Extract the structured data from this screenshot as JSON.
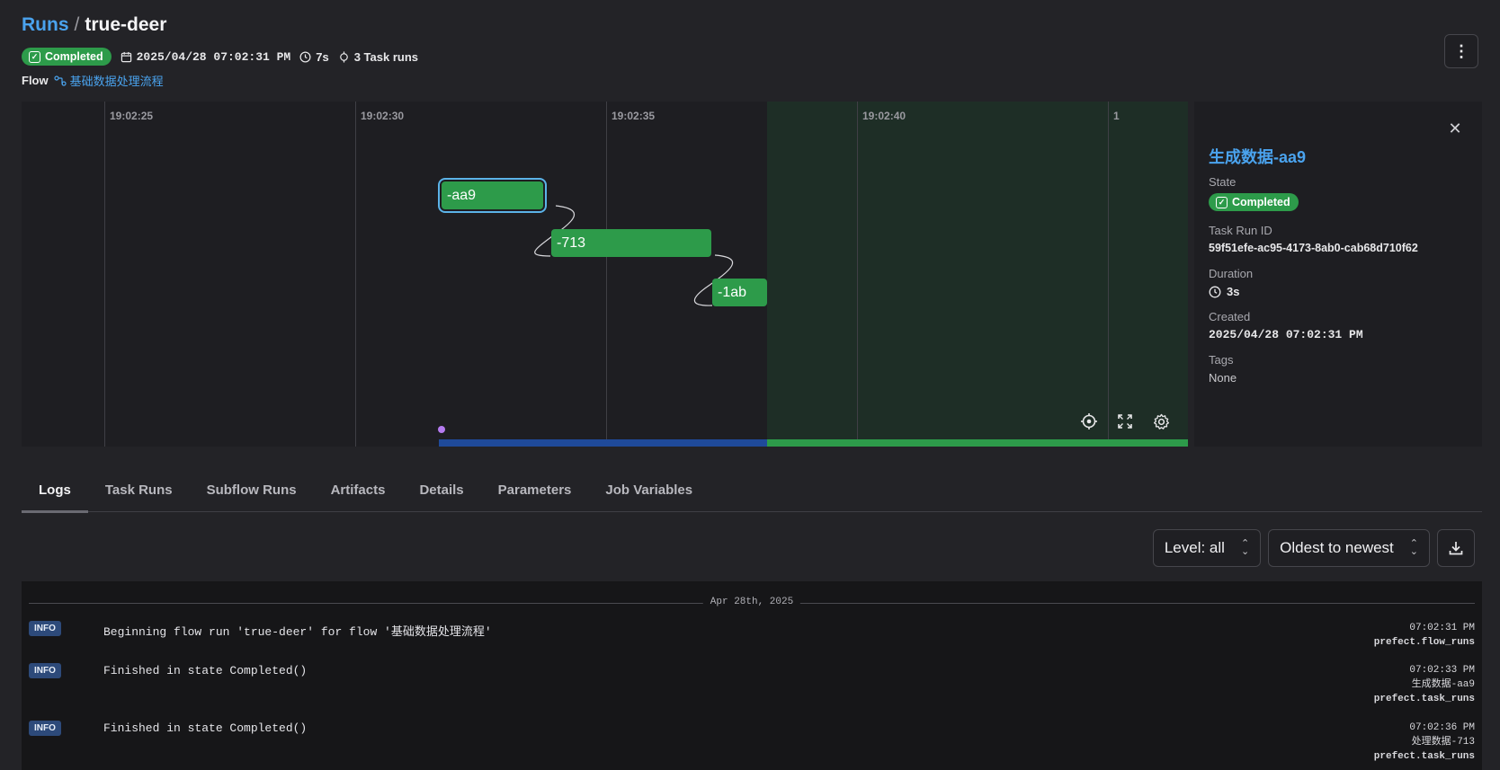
{
  "header": {
    "breadcrumb_root": "Runs",
    "breadcrumb_sep": "/",
    "run_name": "true-deer",
    "state_badge": "Completed",
    "start_time": "2025/04/28 07:02:31 PM",
    "duration": "7s",
    "task_runs": "3 Task runs",
    "flow_label": "Flow",
    "flow_name": "基础数据处理流程",
    "menu_icon": "vertical-ellipsis-icon"
  },
  "timeline": {
    "ticks": [
      "19:02:25",
      "19:02:30",
      "19:02:35",
      "19:02:40",
      "1"
    ],
    "nodes": [
      {
        "label": "-aa9",
        "selected": true
      },
      {
        "label": "-713",
        "selected": false
      },
      {
        "label": "-1ab",
        "selected": false
      }
    ],
    "controls": [
      "crosshair-icon",
      "fullscreen-icon",
      "settings-icon"
    ],
    "colors": {
      "completed": "#2d9b4a",
      "running_bar": "#1f4a9a",
      "selection": "#5bb3e8"
    }
  },
  "panel": {
    "title": "生成数据-aa9",
    "state_label": "State",
    "state_value": "Completed",
    "task_run_id_label": "Task Run ID",
    "task_run_id": "59f51efe-ac95-4173-8ab0-cab68d710f62",
    "duration_label": "Duration",
    "duration_value": "3s",
    "created_label": "Created",
    "created_value": "2025/04/28 07:02:31 PM",
    "tags_label": "Tags",
    "tags_value": "None"
  },
  "tabs": [
    {
      "label": "Logs",
      "active": true
    },
    {
      "label": "Task Runs",
      "active": false
    },
    {
      "label": "Subflow Runs",
      "active": false
    },
    {
      "label": "Artifacts",
      "active": false
    },
    {
      "label": "Details",
      "active": false
    },
    {
      "label": "Parameters",
      "active": false
    },
    {
      "label": "Job Variables",
      "active": false
    }
  ],
  "log_controls": {
    "level": "Level: all",
    "order": "Oldest to newest",
    "download_icon": "download-icon"
  },
  "logs": {
    "date": "Apr 28th, 2025",
    "entries": [
      {
        "level": "INFO",
        "message": "Beginning flow run 'true-deer' for flow '基础数据处理流程'",
        "time": "07:02:31 PM",
        "task": "",
        "logger": "prefect.flow_runs"
      },
      {
        "level": "INFO",
        "message": "Finished in state Completed()",
        "time": "07:02:33 PM",
        "task": "生成数据-aa9",
        "logger": "prefect.task_runs"
      },
      {
        "level": "INFO",
        "message": "Finished in state Completed()",
        "time": "07:02:36 PM",
        "task": "处理数据-713",
        "logger": "prefect.task_runs"
      }
    ]
  }
}
